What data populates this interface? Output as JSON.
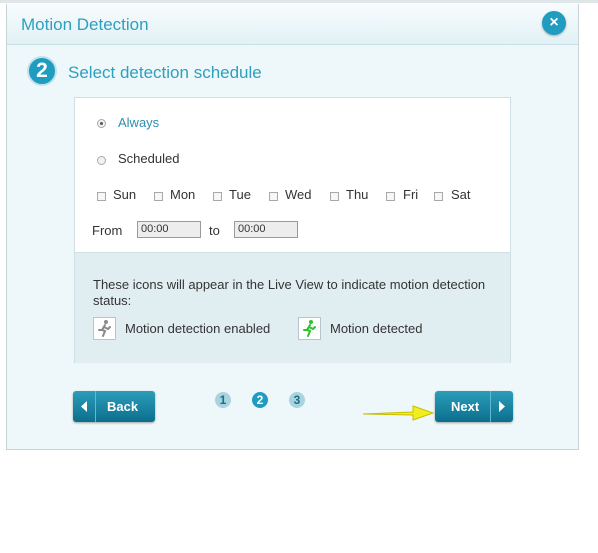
{
  "dialog": {
    "title": "Motion Detection",
    "close_label": "×"
  },
  "step": {
    "number": "2",
    "title": "Select detection schedule"
  },
  "schedule": {
    "options": [
      {
        "label": "Always",
        "selected": true
      },
      {
        "label": "Scheduled",
        "selected": false
      }
    ],
    "days": [
      "Sun",
      "Mon",
      "Tue",
      "Wed",
      "Thu",
      "Fri",
      "Sat"
    ],
    "from_label": "From",
    "from_value": "00:00",
    "to_label": "to",
    "to_value": "00:00"
  },
  "info": {
    "text": "These icons will appear in the Live View to indicate motion detection status:",
    "enabled_label": "Motion detection enabled",
    "detected_label": "Motion detected"
  },
  "nav": {
    "back_label": "Back",
    "next_label": "Next",
    "pages": [
      "1",
      "2",
      "3"
    ],
    "active_page": "2"
  },
  "colors": {
    "accent": "#1f9cc0",
    "title_text": "#2d9fbf",
    "motion_detected_icon": "#2fbf2f",
    "motion_enabled_icon": "#8a8a8a",
    "pointer_arrow": "#f2ee1e"
  },
  "icons": {
    "close": "close-icon",
    "back": "chevron-left-icon",
    "next": "chevron-right-icon",
    "enabled": "running-person-gray-icon",
    "detected": "running-person-green-icon",
    "pointer": "yellow-arrow-icon"
  }
}
